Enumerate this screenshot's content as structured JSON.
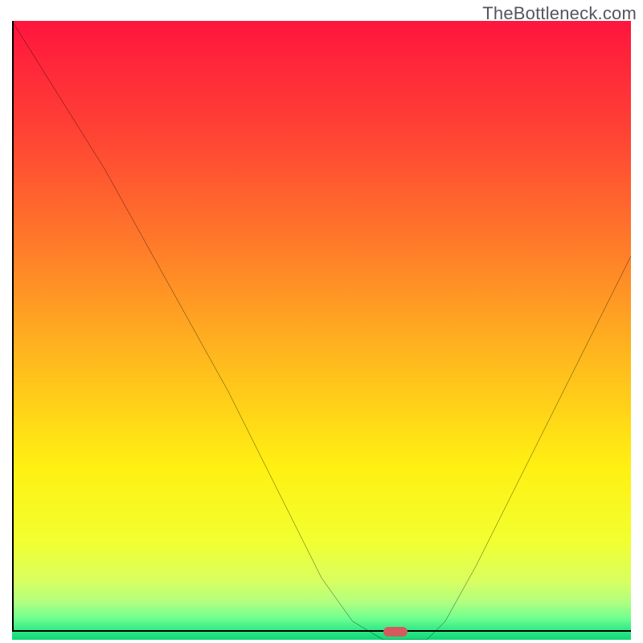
{
  "watermark": "TheBottleneck.com",
  "chart_data": {
    "type": "line",
    "title": "",
    "xlabel": "",
    "ylabel": "",
    "x": [
      0,
      5,
      10,
      15,
      20,
      25,
      30,
      35,
      40,
      45,
      50,
      55,
      60,
      63,
      67,
      70,
      75,
      80,
      85,
      90,
      95,
      100
    ],
    "values": [
      100,
      92,
      84,
      76,
      67,
      58,
      49,
      40,
      30,
      20,
      10,
      3,
      0,
      0,
      0,
      3,
      12,
      22,
      32,
      42,
      52,
      62
    ],
    "xlim": [
      0,
      100
    ],
    "ylim": [
      0,
      100
    ],
    "marker_x": 62,
    "marker_y": 0,
    "gradient_stops": [
      {
        "offset": 0.0,
        "color": "#ff153e"
      },
      {
        "offset": 0.18,
        "color": "#ff4234"
      },
      {
        "offset": 0.36,
        "color": "#ff7a2a"
      },
      {
        "offset": 0.54,
        "color": "#ffb71e"
      },
      {
        "offset": 0.72,
        "color": "#fff012"
      },
      {
        "offset": 0.84,
        "color": "#f2ff30"
      },
      {
        "offset": 0.905,
        "color": "#d8ff60"
      },
      {
        "offset": 0.94,
        "color": "#b0ff80"
      },
      {
        "offset": 0.965,
        "color": "#70ff90"
      },
      {
        "offset": 0.985,
        "color": "#30e886"
      },
      {
        "offset": 1.0,
        "color": "#10d878"
      }
    ]
  }
}
